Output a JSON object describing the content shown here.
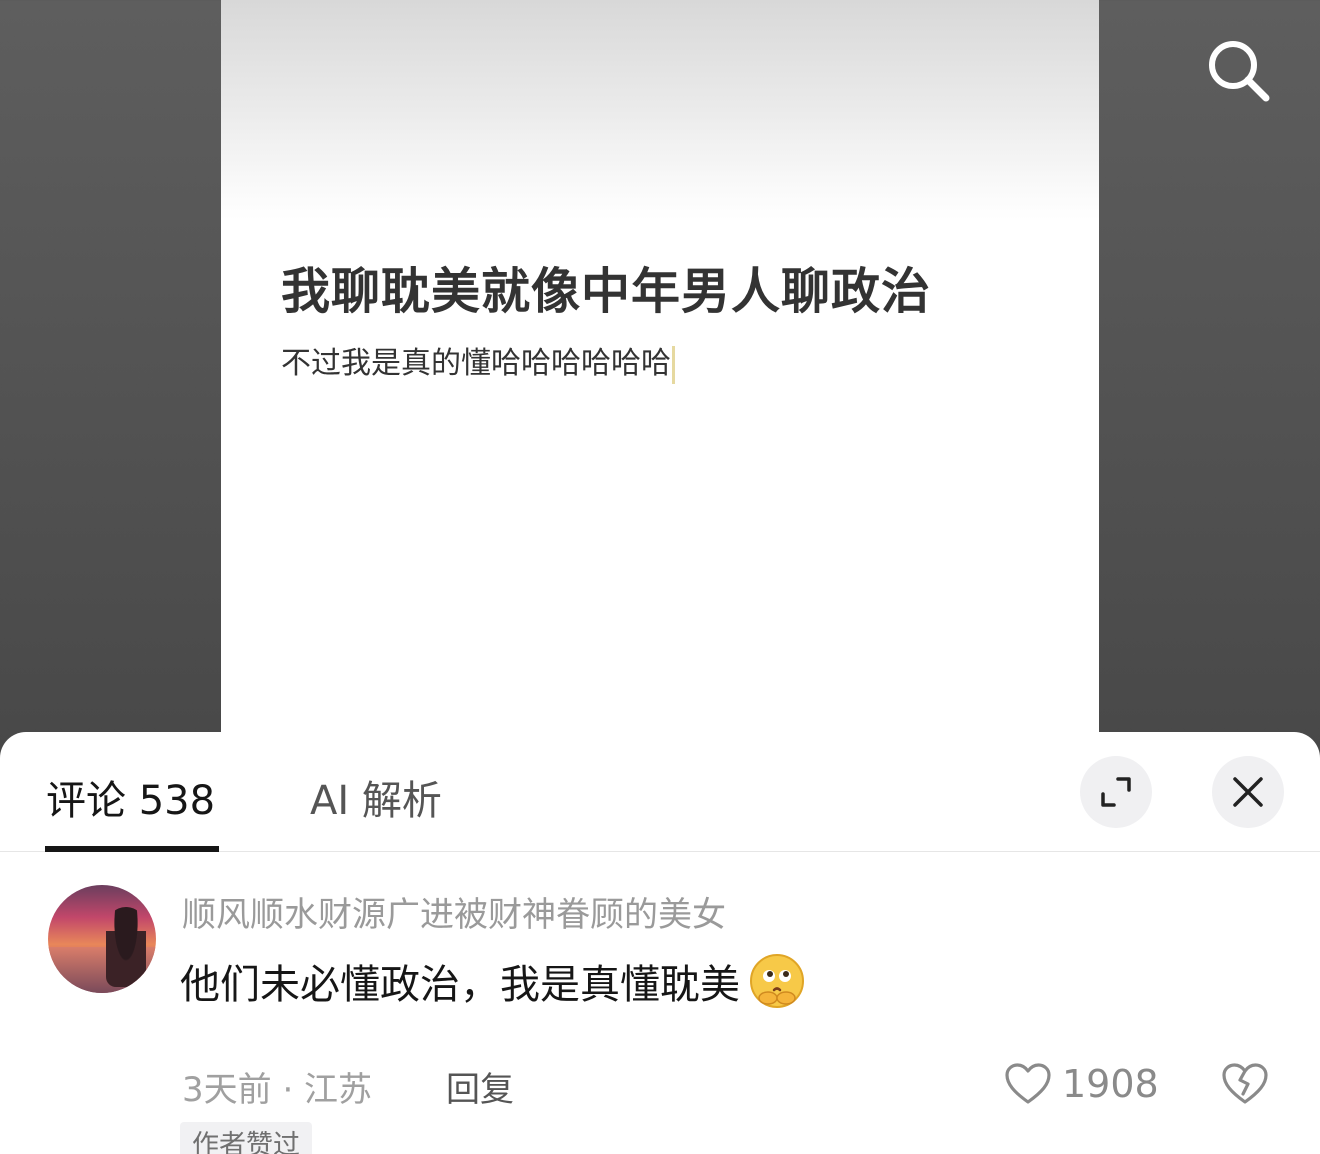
{
  "post": {
    "title": "我聊耽美就像中年男人聊政治",
    "body": "不过我是真的懂哈哈哈哈哈哈"
  },
  "sheet": {
    "tabs": [
      {
        "label": "评论 538",
        "active": true
      },
      {
        "label": "AI 解析",
        "active": false
      }
    ]
  },
  "comment": {
    "username": "顺风顺水财源广进被财神眷顾的美女",
    "text": "他们未必懂政治，我是真懂耽美",
    "emoji": "thinking-face-emoji",
    "time": "3天前",
    "location": "江苏",
    "meta": "3天前 · 江苏",
    "reply_label": "回复",
    "likes": "1908",
    "author_badge": "作者赞过"
  },
  "icons": {
    "search": "search-icon",
    "expand": "expand-icon",
    "close": "close-icon",
    "like": "heart-icon",
    "dislike": "broken-heart-icon"
  },
  "colors": {
    "text_primary": "#161616",
    "text_secondary": "#9a9a9a",
    "sheet_bg": "#ffffff",
    "button_bg": "#f0f0f2"
  }
}
